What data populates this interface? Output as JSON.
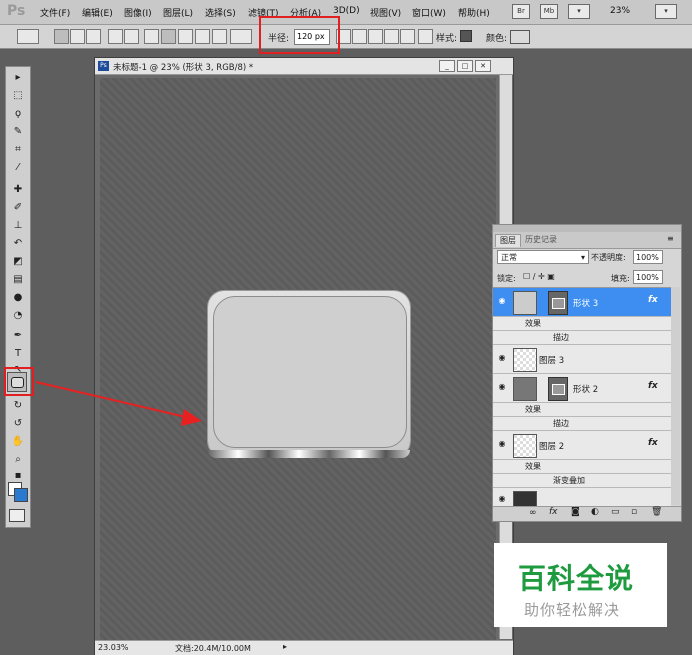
{
  "app": {
    "logo": "Ps"
  },
  "menu": [
    "文件(F)",
    "编辑(E)",
    "图像(I)",
    "图层(L)",
    "选择(S)",
    "滤镜(T)",
    "分析(A)",
    "3D(D)",
    "视图(V)",
    "窗口(W)",
    "帮助(H)"
  ],
  "menubar_right": {
    "bridge": "Br",
    "minibridge": "Mb",
    "zoom": "23%"
  },
  "options": {
    "radius_label": "半径:",
    "radius_value": "120 px",
    "style_label": "样式:",
    "color_label": "颜色:"
  },
  "document": {
    "title": "未标题-1 @ 23% (形状 3, RGB/8) *",
    "zoom": "23.03%",
    "doc_info": "文档:20.4M/10.00M"
  },
  "layers_panel": {
    "tabs": [
      "图层",
      "历史记录"
    ],
    "blend_mode": "正常",
    "opacity_label": "不透明度:",
    "opacity": "100%",
    "lock_label": "锁定:",
    "fill_label": "填充:",
    "fill": "100%",
    "layers": [
      {
        "name": "形状 3",
        "effects_label": "效果",
        "effect": "描边",
        "fx": "fx"
      },
      {
        "name": "图层 3"
      },
      {
        "name": "形状 2",
        "effects_label": "效果",
        "effect": "描边",
        "fx": "fx"
      },
      {
        "name": "图层 2",
        "effects_label": "效果",
        "effect": "渐变叠加",
        "fx": "fx"
      }
    ]
  },
  "watermark": {
    "title": "百科全说",
    "subtitle": "助你轻松解决"
  },
  "colors": {
    "highlight": "#e02020",
    "selection": "#3d8ef0",
    "watermark_green": "#1f9b3f"
  }
}
